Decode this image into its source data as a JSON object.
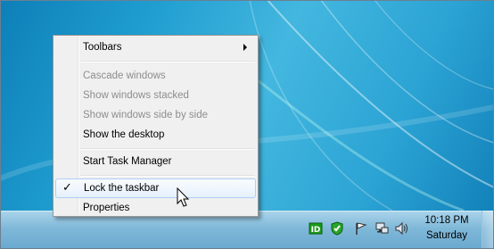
{
  "menu": {
    "toolbars": "Toolbars",
    "cascade": "Cascade windows",
    "stacked": "Show windows stacked",
    "side_by_side": "Show windows side by side",
    "show_desktop": "Show the desktop",
    "task_manager": "Start Task Manager",
    "lock_taskbar": "Lock the taskbar",
    "properties": "Properties",
    "check_glyph": "✓"
  },
  "tray": {
    "icons": [
      "id-icon",
      "shield-check-icon",
      "flag-icon",
      "network-icon",
      "speaker-icon"
    ],
    "time": "10:18 PM",
    "day": "Saturday"
  },
  "colors": {
    "desktop": "#2ba3d4",
    "menu_bg": "#f0f0f0",
    "disabled_text": "#8d8d8d",
    "highlight_border": "#aecff7"
  }
}
